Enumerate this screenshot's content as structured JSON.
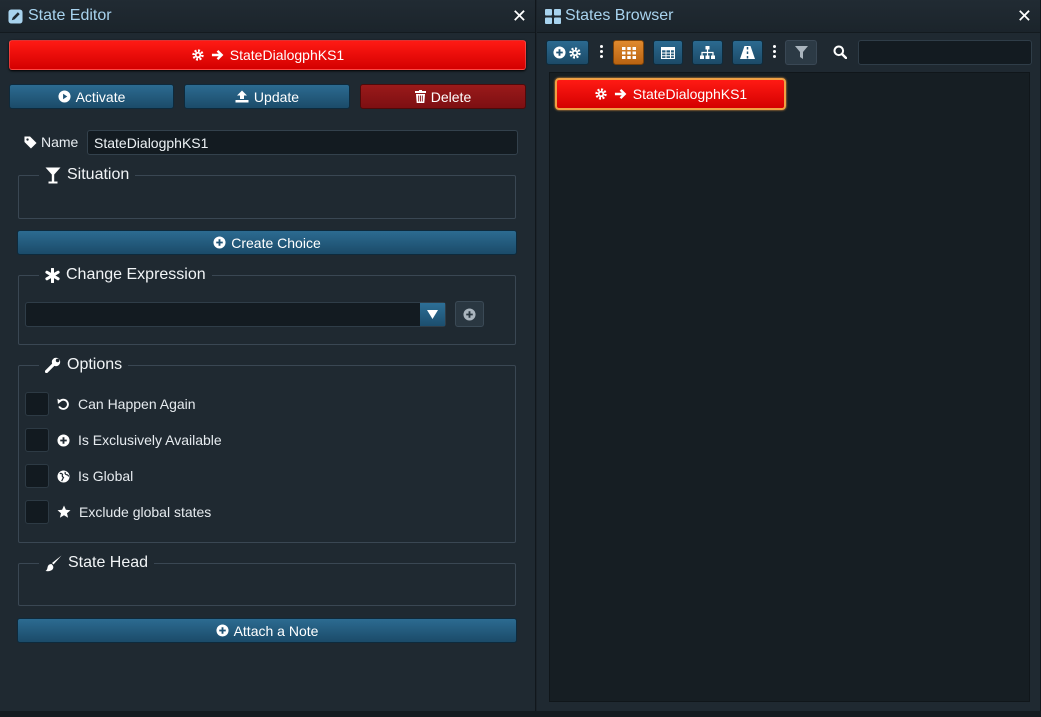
{
  "editor": {
    "title": "State Editor",
    "state_button_label": "StateDialogphKS1",
    "activate_label": "Activate",
    "update_label": "Update",
    "delete_label": "Delete",
    "name_label": "Name",
    "name_value": "StateDialogphKS1",
    "situation_legend": "Situation",
    "create_choice_label": "Create Choice",
    "change_expression_legend": "Change Expression",
    "change_expression_value": "",
    "options_legend": "Options",
    "options": [
      {
        "label": "Can Happen Again",
        "icon": "undo-icon",
        "checked": false
      },
      {
        "label": "Is Exclusively Available",
        "icon": "plus-circle-icon",
        "checked": false
      },
      {
        "label": "Is Global",
        "icon": "globe-icon",
        "checked": false
      },
      {
        "label": "Exclude global states",
        "icon": "star-icon",
        "checked": false
      }
    ],
    "state_head_legend": "State Head",
    "attach_note_label": "Attach a Note"
  },
  "browser": {
    "title": "States Browser",
    "search_value": "",
    "active_view": "grid",
    "node_label": "StateDialogphKS1"
  },
  "colors": {
    "accent_blue": "#2c6b91",
    "state_red": "#e00a05",
    "active_orange": "#e08a2e",
    "title_text": "#a8d3ee"
  }
}
